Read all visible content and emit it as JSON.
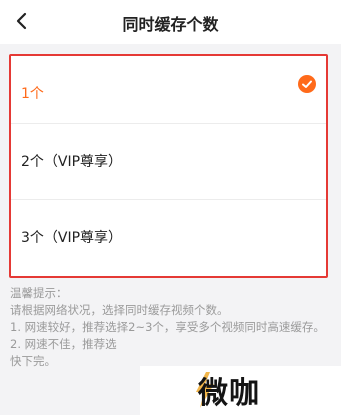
{
  "header": {
    "title": "同时缓存个数"
  },
  "options": [
    {
      "label": "1个",
      "selected": true
    },
    {
      "label": "2个（VIP尊享）",
      "selected": false
    },
    {
      "label": "3个（VIP尊享）",
      "selected": false
    }
  ],
  "tips": {
    "lines": [
      "温馨提示：",
      "请根据网络状况，选择同时缓存视频个数。",
      "1. 网速较好，推荐选择2~3个，享受多个视频同时高速缓存。",
      "2. 网速不佳，推荐选",
      "快下完。"
    ]
  },
  "watermark": {
    "text": "微咖"
  },
  "colors": {
    "accent": "#ff6a1a",
    "highlight_border": "#e53935"
  }
}
